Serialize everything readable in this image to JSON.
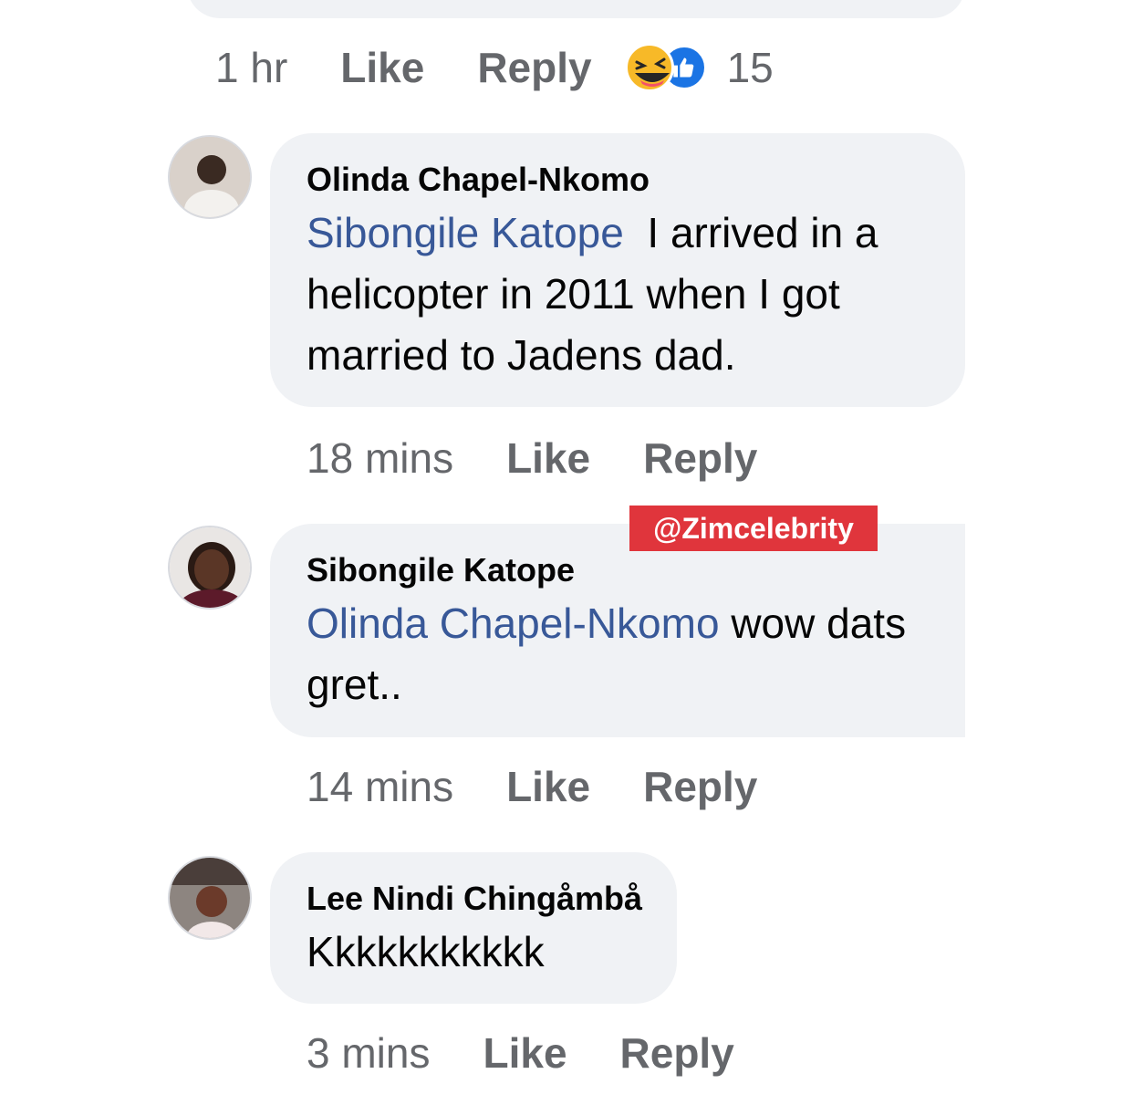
{
  "top_actions": {
    "time": "1 hr",
    "like": "Like",
    "reply": "Reply",
    "reaction_count": "15"
  },
  "reaction_icons": [
    "haha-icon",
    "like-icon"
  ],
  "comments": [
    {
      "author": "Olinda Chapel-Nkomo",
      "mention": "Sibongile Katope",
      "text_line1": "I arrived in a",
      "text_line2": "helicopter in 2011 when I got",
      "text_line3": "married to Jadens dad.",
      "time": "18 mins",
      "like": "Like",
      "reply": "Reply"
    },
    {
      "author": "Sibongile Katope",
      "mention": "Olinda Chapel-Nkomo",
      "text_line1": "wow dats",
      "text_line2": "gret..",
      "time": "14 mins",
      "like": "Like",
      "reply": "Reply"
    },
    {
      "author": "Lee Nindi Chingåmbå",
      "text_line1": "Kkkkkkkkkkk",
      "time": "3 mins",
      "like": "Like",
      "reply": "Reply"
    }
  ],
  "watermark": "@Zimcelebrity",
  "colors": {
    "bubble": "#f0f2f5",
    "mention": "#385898",
    "meta": "#65676b",
    "watermark_bg": "#e0353c"
  }
}
